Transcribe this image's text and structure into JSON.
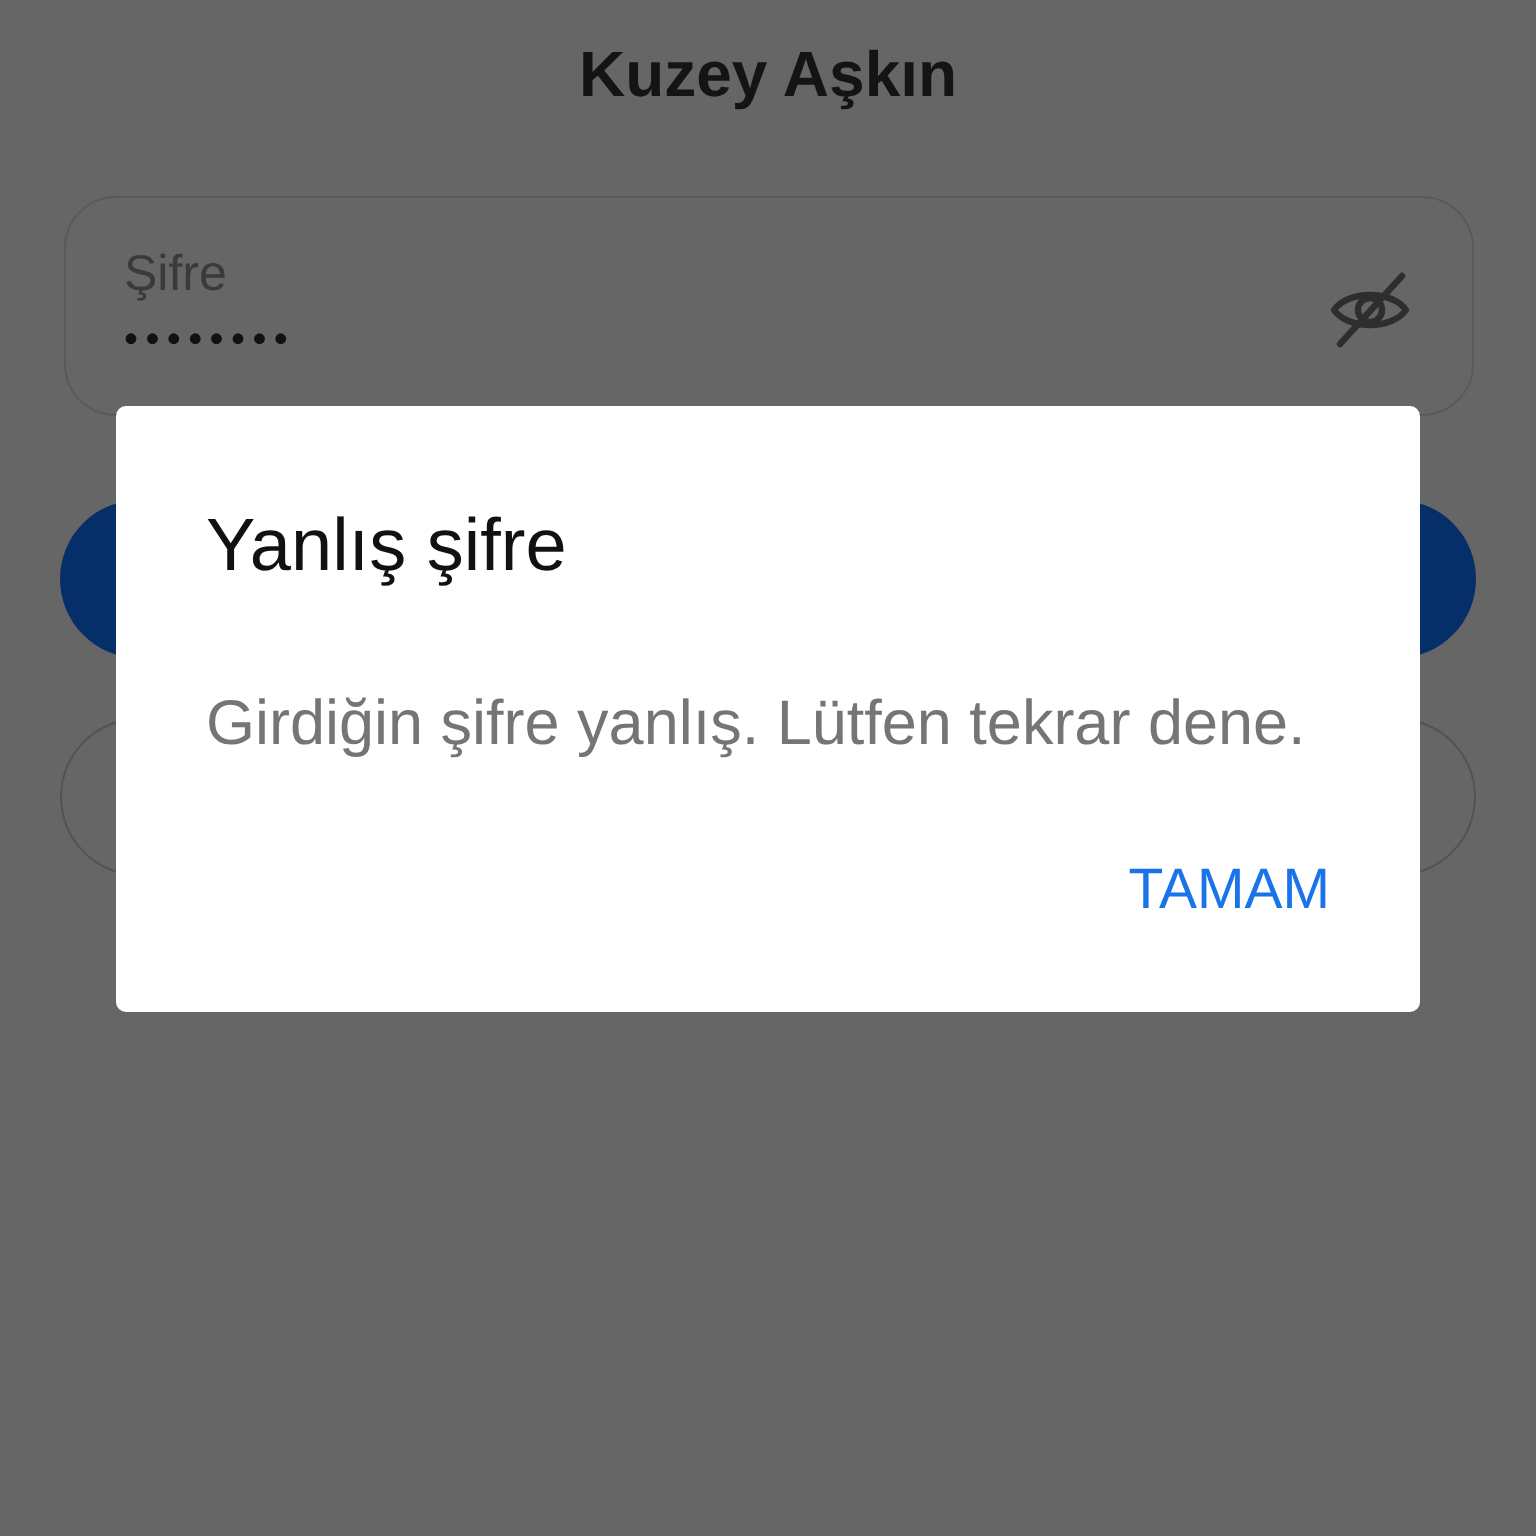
{
  "screen": {
    "title": "Kuzey Aşkın",
    "password_field": {
      "label": "Şifre",
      "value": "••••••••"
    },
    "buttons": [
      {
        "kind": "filled"
      },
      {
        "kind": "outlined"
      }
    ]
  },
  "dialog": {
    "title": "Yanlış şifre",
    "message": "Girdiğin şifre yanlış. Lütfen tekrar dene.",
    "buttons": [
      {
        "label": "TAMAM"
      }
    ]
  }
}
